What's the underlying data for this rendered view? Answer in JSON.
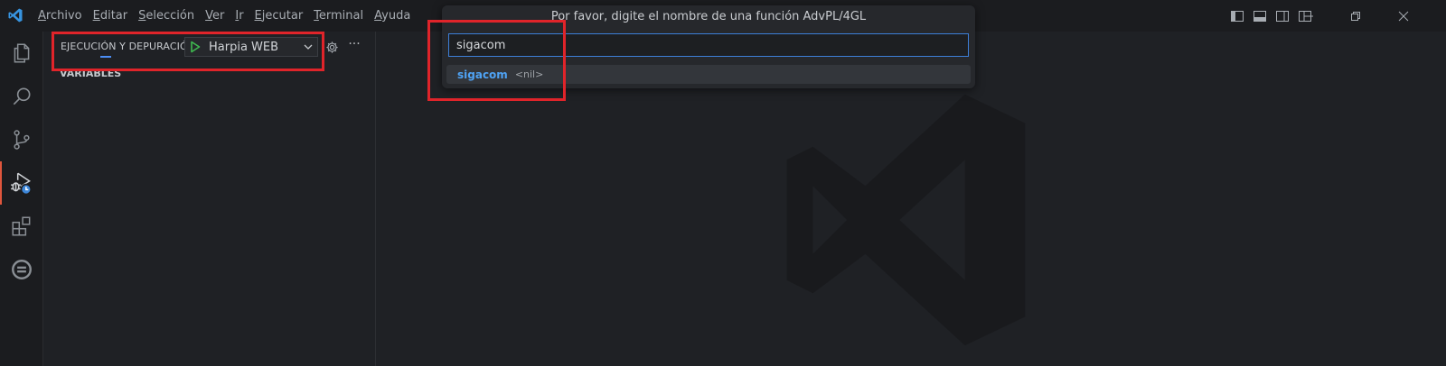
{
  "menu": {
    "items": [
      {
        "mnemonic": "A",
        "rest": "rchivo"
      },
      {
        "mnemonic": "E",
        "rest": "ditar"
      },
      {
        "mnemonic": "S",
        "rest": "elección"
      },
      {
        "mnemonic": "V",
        "rest": "er"
      },
      {
        "mnemonic": "I",
        "rest": "r"
      },
      {
        "mnemonic": "E",
        "rest": "jecutar"
      },
      {
        "mnemonic": "T",
        "rest": "erminal"
      },
      {
        "mnemonic": "A",
        "rest": "yuda"
      }
    ]
  },
  "quick_input": {
    "title": "Por favor, digite el nombre de una función AdvPL/4GL",
    "value": "sigacom",
    "item_label": "sigacom",
    "item_description": "<nil>"
  },
  "sidebar": {
    "title": "EJECUCIÓN Y DEPURACIÓN",
    "launch_config": "Harpia WEB",
    "more": "···",
    "section": "VARIABLES"
  },
  "activity_icons": [
    "explorer-icon",
    "search-icon",
    "source-control-icon",
    "run-debug-icon",
    "extensions-icon",
    "totvs-icon"
  ],
  "colors": {
    "accent": "#4c8ef5",
    "active_indicator": "#e0563d",
    "annotation_red": "#e0242a",
    "play_green": "#3fb950"
  }
}
